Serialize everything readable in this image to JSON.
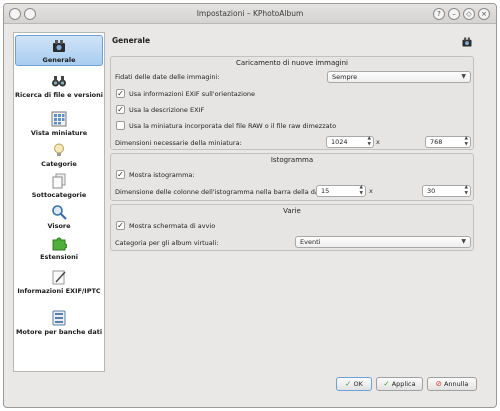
{
  "window": {
    "title": "Impostazioni – KPhotoAlbum"
  },
  "titlebar_buttons": {
    "help": "?",
    "minimize": "–",
    "maximize": "◇",
    "close": "×"
  },
  "sidebar": {
    "items": [
      {
        "label": "Generale",
        "icon": "binoculars-camera-icon"
      },
      {
        "label": "Ricerca di file e versioni",
        "icon": "binoculars-icon"
      },
      {
        "label": "Vista miniature",
        "icon": "thumbnail-grid-icon"
      },
      {
        "label": "Categorie",
        "icon": "lightbulb-icon"
      },
      {
        "label": "Sottocategorie",
        "icon": "pages-icon"
      },
      {
        "label": "Visore",
        "icon": "magnifier-icon"
      },
      {
        "label": "Estensioni",
        "icon": "puzzle-icon"
      },
      {
        "label": "Informazioni EXIF/IPTC",
        "icon": "pen-paper-icon"
      },
      {
        "label": "Motore per banche dati",
        "icon": "database-icon"
      }
    ]
  },
  "main": {
    "title": "Generale"
  },
  "loading": {
    "title": "Caricamento di nuove immagini",
    "trust_label": "Fidati delle date delle immagini:",
    "trust_value": "Sempre",
    "exif_orientation": "Usa informazioni EXIF sull'orientazione",
    "exif_description": "Usa la descrizione EXIF",
    "raw_thumbnail": "Usa la miniatura incorporata del file RAW o il file raw dimezzato",
    "thumb_size_label": "Dimensioni necessarie della miniatura:",
    "thumb_w": "1024",
    "thumb_h": "768",
    "times": "x"
  },
  "histogram": {
    "title": "Istogramma",
    "show": "Mostra istogramma:",
    "size_label": "Dimensione delle colonne dell'istogramma nella barra della data:",
    "w": "15",
    "h": "30",
    "times": "x"
  },
  "misc": {
    "title": "Varie",
    "splash": "Mostra schermata di avvio",
    "album_label": "Categoria per gli album virtuali:",
    "album_value": "Eventi"
  },
  "buttons": {
    "ok": "OK",
    "apply": "Applica",
    "cancel": "Annulla"
  },
  "colors": {
    "accent": "#6ca0d6",
    "apply_green": "#3a9a3a",
    "cancel_red": "#c43b2f"
  }
}
